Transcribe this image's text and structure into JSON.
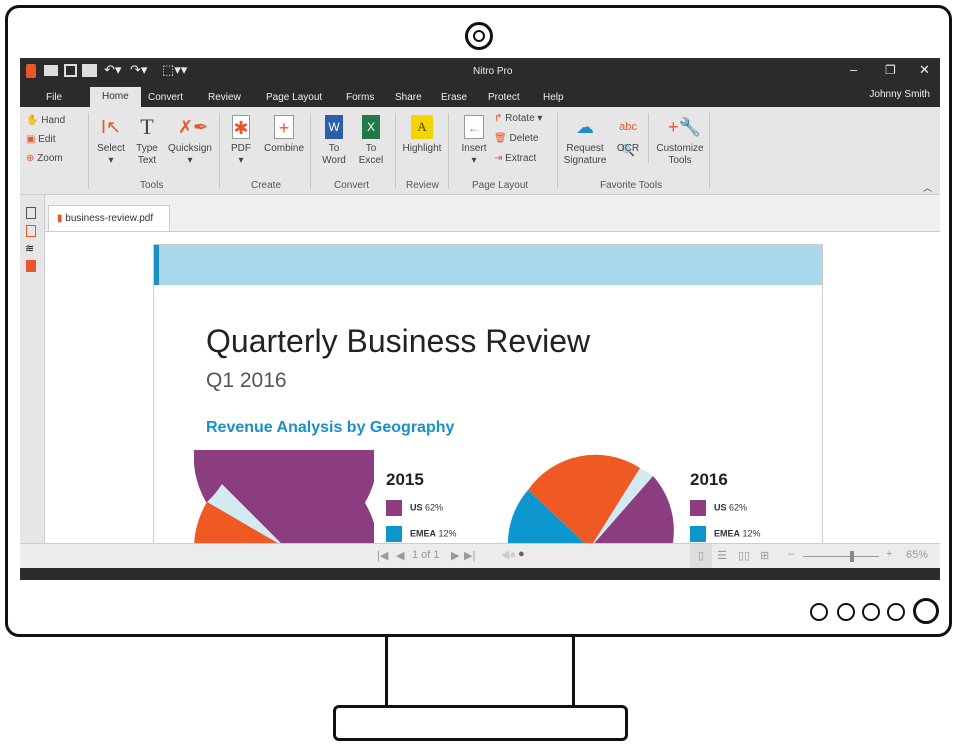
{
  "window": {
    "title": "Nitro Pro",
    "user": "Johnny Smith"
  },
  "tabs": [
    "File",
    "Home",
    "Convert",
    "Review",
    "Page Layout",
    "Forms",
    "Share",
    "Erase",
    "Protect",
    "Help"
  ],
  "ribbon": {
    "nav": [
      "Hand",
      "Edit",
      "Zoom"
    ],
    "tools": {
      "select": "Select",
      "type_text": [
        "Type",
        "Text"
      ],
      "quicksign": "Quicksign",
      "label": "Tools"
    },
    "create": {
      "pdf": "PDF",
      "combine": "Combine",
      "label": "Create"
    },
    "convert": {
      "to_word": [
        "To",
        "Word"
      ],
      "to_excel": [
        "To",
        "Excel"
      ],
      "label": "Convert"
    },
    "review": {
      "highlight": "Highlight",
      "label": "Review"
    },
    "page_layout": {
      "insert": "Insert",
      "rotate": "Rotate",
      "delete": "Delete",
      "extract": "Extract",
      "label": "Page Layout"
    },
    "favorite": {
      "request_signature": [
        "Request",
        "Signature"
      ],
      "ocr": "OCR",
      "customize": [
        "Customize",
        "Tools"
      ],
      "label": "Favorite Tools"
    }
  },
  "document": {
    "tab": "business-review.pdf",
    "title": "Quarterly Business Review",
    "subtitle": "Q1 2016",
    "section": "Revenue Analysis by Geography",
    "charts": [
      {
        "year": "2015",
        "legend": [
          {
            "label": "US",
            "value": "62%",
            "color": "#8b3d7f"
          },
          {
            "label": "EMEA",
            "value": "12%",
            "color": "#0e97cf"
          }
        ]
      },
      {
        "year": "2016",
        "legend": [
          {
            "label": "US",
            "value": "62%",
            "color": "#8b3d7f"
          },
          {
            "label": "EMEA",
            "value": "12%",
            "color": "#0e97cf"
          }
        ]
      }
    ]
  },
  "status": {
    "page": "1 of 1",
    "zoom": "65%",
    "zoom_level": 0.65
  },
  "colors": {
    "accent": "#e8562a",
    "header_band": "#a8d8ea",
    "pie_orange": "#ef5a24",
    "pie_light": "#d4eaf3"
  }
}
